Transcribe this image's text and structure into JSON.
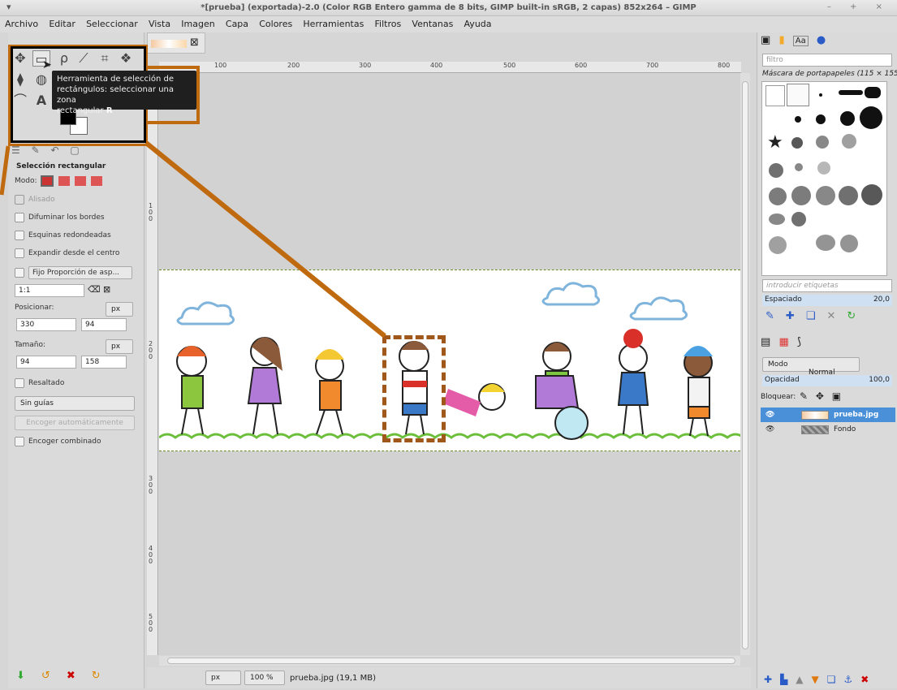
{
  "window": {
    "title": "*[prueba] (exportada)-2.0 (Color RGB Entero gamma de 8 bits, GIMP built-in sRGB, 2 capas) 852x264 – GIMP",
    "controls": "– + ×"
  },
  "menubar": [
    "Archivo",
    "Editar",
    "Seleccionar",
    "Vista",
    "Imagen",
    "Capa",
    "Colores",
    "Herramientas",
    "Filtros",
    "Ventanas",
    "Ayuda"
  ],
  "tooltip": {
    "line1": "Herramienta de selección de",
    "line2": "rectángulos: seleccionar una zona",
    "line3_prefix": "rectangular",
    "shortcut": "R"
  },
  "tool_options": {
    "title": "Selección rectangular",
    "mode_label": "Modo:",
    "antialias": "Alisado",
    "feather": "Difuminar los bordes",
    "rounded": "Esquinas redondeadas",
    "expand_center": "Expandir desde el centro",
    "fixed_label": "Fijo",
    "fixed_value": "Proporción de asp...",
    "ratio_value": "1:1",
    "position_label": "Posicionar:",
    "position_unit": "px",
    "position_x": "330",
    "position_y": "94",
    "size_label": "Tamaño:",
    "size_unit": "px",
    "size_w": "94",
    "size_h": "158",
    "highlight": "Resaltado",
    "guides": "Sin guías",
    "autoshrink": "Encoger automáticamente",
    "shrink_merged": "Encoger combinado"
  },
  "ruler": {
    "h_ticks": [
      "100",
      "200",
      "300",
      "400",
      "500",
      "600",
      "700",
      "800"
    ],
    "v_ticks": [
      "100",
      "200",
      "300",
      "400",
      "500"
    ]
  },
  "status": {
    "unit": "px",
    "zoom": "100 %",
    "filename": "prueba.jpg (19,1 MB)"
  },
  "brushes_panel": {
    "filter_placeholder": "filtro",
    "title": "Máscara de portapapeles (115 × 155)",
    "tags_placeholder": "introducir etiquetas",
    "spacing_label": "Espaciado",
    "spacing_value": "20,0"
  },
  "layers_panel": {
    "mode_label": "Modo",
    "mode_value": "Normal",
    "opacity_label": "Opacidad",
    "opacity_value": "100,0",
    "lock_label": "Bloquear:",
    "layers": [
      {
        "name": "prueba.jpg",
        "selected": true
      },
      {
        "name": "Fondo",
        "selected": false
      }
    ]
  },
  "colors": {
    "accent_orange": "#c06a10",
    "selection_blue": "#4a90d9"
  }
}
